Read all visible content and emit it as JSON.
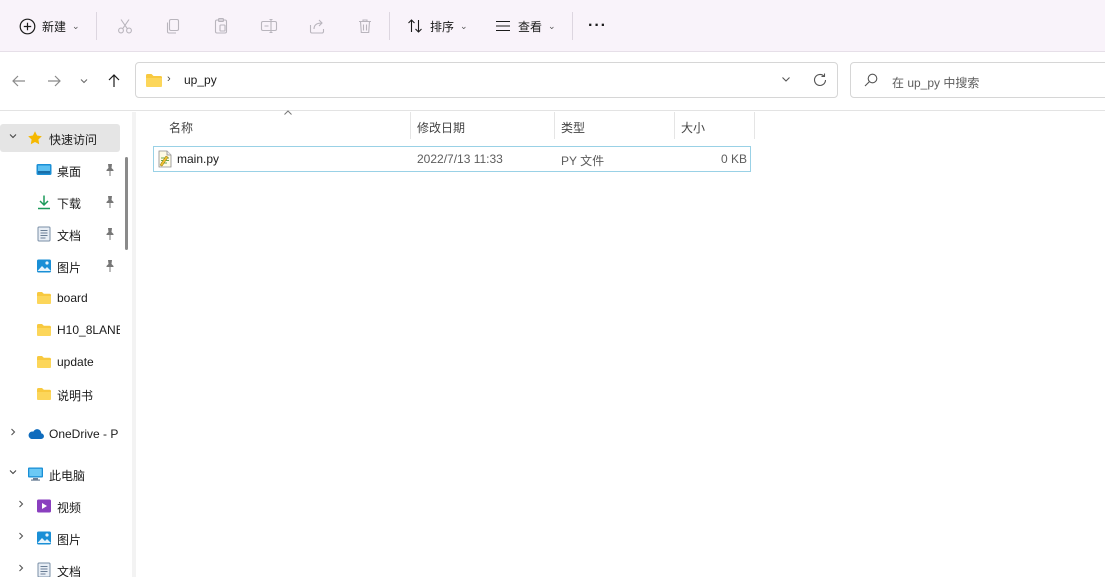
{
  "toolbar": {
    "new_label": "新建",
    "sort_label": "排序",
    "view_label": "查看",
    "more_label": "···"
  },
  "address": {
    "crumb": "up_py",
    "search_placeholder": "在 up_py 中搜索"
  },
  "sidebar": {
    "quick_access": "快速访问",
    "items": [
      {
        "label": "桌面",
        "icon": "desktop-icon",
        "pinned": true
      },
      {
        "label": "下载",
        "icon": "download-icon",
        "pinned": true
      },
      {
        "label": "文档",
        "icon": "document-icon",
        "pinned": true
      },
      {
        "label": "图片",
        "icon": "pictures-icon",
        "pinned": true
      },
      {
        "label": "board",
        "icon": "folder-icon",
        "pinned": false
      },
      {
        "label": "H10_8LANE",
        "icon": "folder-icon",
        "pinned": false
      },
      {
        "label": "update",
        "icon": "folder-icon",
        "pinned": false
      },
      {
        "label": "说明书",
        "icon": "folder-icon",
        "pinned": false
      }
    ],
    "onedrive": "OneDrive - P",
    "this_pc": "此电脑",
    "pc_items": [
      {
        "label": "视频",
        "icon": "video-icon"
      },
      {
        "label": "图片",
        "icon": "pictures-icon"
      },
      {
        "label": "文档",
        "icon": "document-icon"
      }
    ]
  },
  "columns": {
    "name": "名称",
    "date": "修改日期",
    "type": "类型",
    "size": "大小"
  },
  "files": [
    {
      "name": "main.py",
      "date": "2022/7/13 11:33",
      "type": "PY 文件",
      "size": "0 KB"
    }
  ],
  "colors": {
    "toolbar_bg": "#f9f3fa",
    "selection_border": "#99d1e6",
    "folder": "#f8c93f",
    "accent": "#0067c0"
  }
}
